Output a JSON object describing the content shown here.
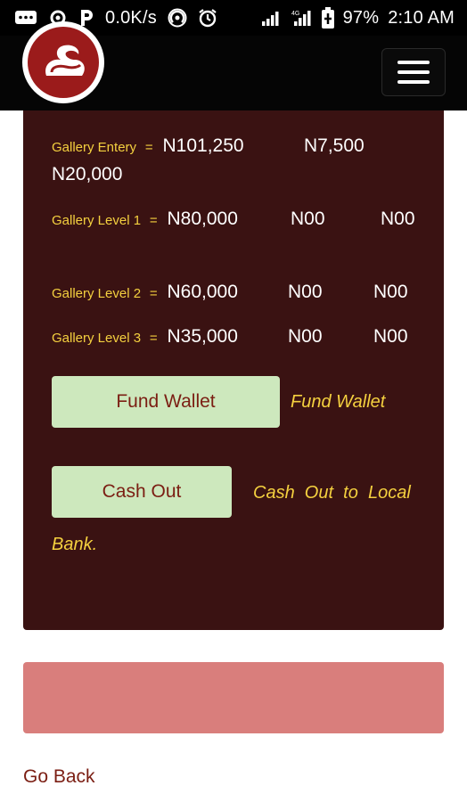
{
  "status_bar": {
    "speed": "0.0K/s",
    "battery": "97%",
    "time": "2:10 AM",
    "icons": [
      "message-icon",
      "settings-icon",
      "parking-icon",
      "hotspot-icon",
      "alarm-icon",
      "signal-icon",
      "signal-4g-icon",
      "battery-icon"
    ]
  },
  "header": {
    "logo_icon": "brand-logo-icon",
    "menu_icon": "hamburger-menu-icon"
  },
  "gallery": {
    "entry": {
      "label": "Gallery Entery",
      "eq": "=",
      "v1": "N101,250",
      "v2": "N7,500",
      "v3": "N20,000"
    },
    "level1": {
      "label": "Gallery Level 1",
      "eq": "=",
      "v1": "N80,000",
      "v2": "N00",
      "v3": "N00"
    },
    "level2": {
      "label": "Gallery Level 2",
      "eq": "=",
      "v1": "N60,000",
      "v2": "N00",
      "v3": "N00"
    },
    "level3": {
      "label": "Gallery Level 3",
      "eq": "=",
      "v1": "N35,000",
      "v2": "N00",
      "v3": "N00"
    }
  },
  "actions": {
    "fund_wallet_label": "Fund Wallet",
    "fund_wallet_note": "Fund Wallet",
    "cash_out_label": "Cash Out",
    "cash_out_note_line1": "Cash  Out  to  Local",
    "cash_out_note_line2": "Bank."
  },
  "footer": {
    "go_back": "Go Back"
  },
  "colors": {
    "card_bg": "#3a1212",
    "label_yellow": "#f4d03f",
    "button_green": "#cde8bd",
    "button_text": "#7b1e13",
    "alert_pink": "#d97e7c",
    "brand_red": "#9b1b1b"
  }
}
